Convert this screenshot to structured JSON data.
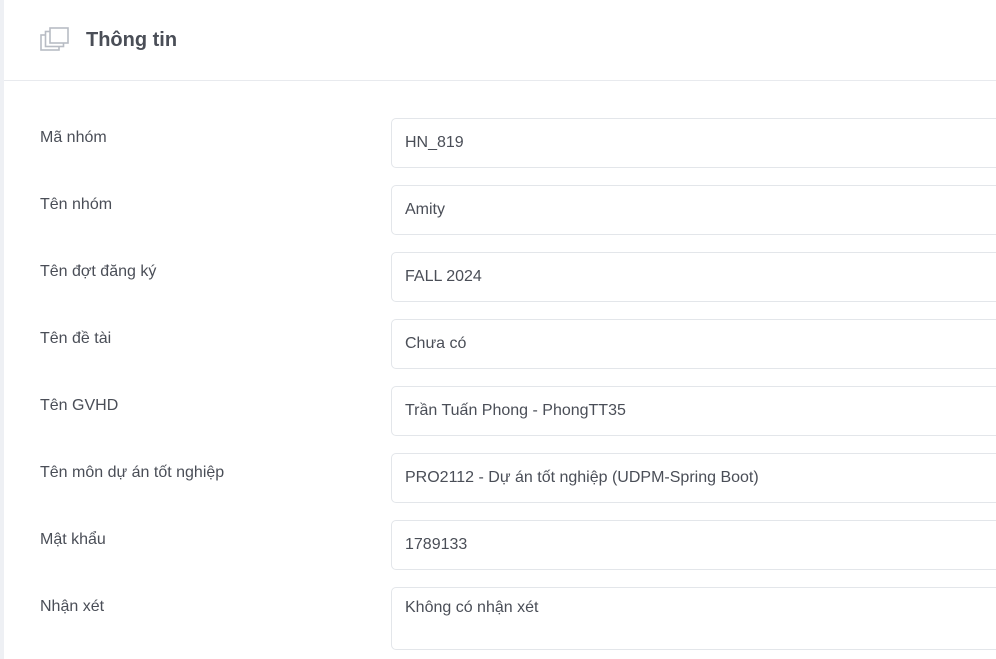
{
  "header": {
    "title": "Thông tin",
    "icon": "layers-icon"
  },
  "fields": [
    {
      "label": "Mã nhóm",
      "value": "HN_819"
    },
    {
      "label": "Tên nhóm",
      "value": "Amity"
    },
    {
      "label": "Tên đợt đăng ký",
      "value": "FALL 2024"
    },
    {
      "label": "Tên đề tài",
      "value": "Chưa có"
    },
    {
      "label": "Tên GVHD",
      "value": "Trần Tuấn Phong - PhongTT35"
    },
    {
      "label": "Tên môn dự án tốt nghiệp",
      "value": "PRO2112 - Dự án tốt nghiệp (UDPM-Spring Boot)"
    },
    {
      "label": "Mật khẩu",
      "value": "1789133"
    },
    {
      "label": "Nhận xét",
      "value": "Không có nhận xét"
    }
  ],
  "colors": {
    "text": "#4a4e57",
    "border": "#e3e6ea",
    "background": "#ffffff"
  }
}
